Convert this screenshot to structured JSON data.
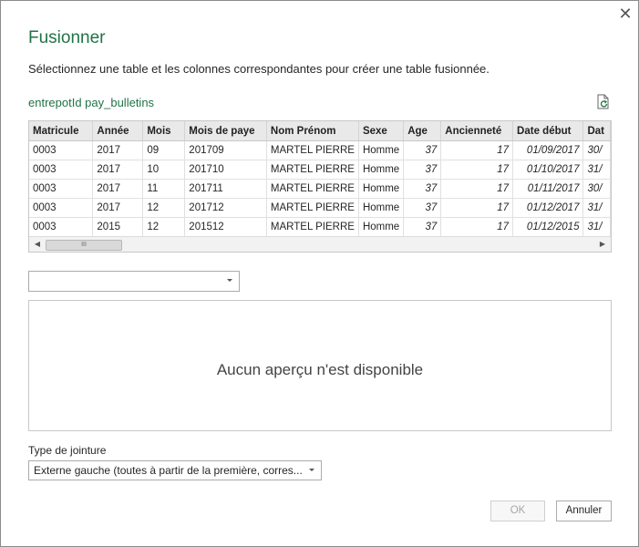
{
  "dialog": {
    "title": "Fusionner",
    "subtitle": "Sélectionnez une table et les colonnes correspondantes pour créer une table fusionnée.",
    "table_name": "entrepotId pay_bulletins",
    "close_glyph": "✕"
  },
  "grid": {
    "columns": [
      "Matricule",
      "Année",
      "Mois",
      "Mois de paye",
      "Nom Prénom",
      "Sexe",
      "Age",
      "Ancienneté",
      "Date début",
      "Dat"
    ],
    "rows": [
      [
        "0003",
        "2017",
        "09",
        "201709",
        "MARTEL PIERRE",
        "Homme",
        "37",
        "17",
        "01/09/2017",
        "30/"
      ],
      [
        "0003",
        "2017",
        "10",
        "201710",
        "MARTEL PIERRE",
        "Homme",
        "37",
        "17",
        "01/10/2017",
        "31/"
      ],
      [
        "0003",
        "2017",
        "11",
        "201711",
        "MARTEL PIERRE",
        "Homme",
        "37",
        "17",
        "01/11/2017",
        "30/"
      ],
      [
        "0003",
        "2017",
        "12",
        "201712",
        "MARTEL PIERRE",
        "Homme",
        "37",
        "17",
        "01/12/2017",
        "31/"
      ],
      [
        "0003",
        "2015",
        "12",
        "201512",
        "MARTEL PIERRE",
        "Homme",
        "37",
        "17",
        "01/12/2015",
        "31/"
      ]
    ],
    "scroll_left": "◀",
    "scroll_right": "▶",
    "scroll_grip": "III"
  },
  "second_table": {
    "selected": ""
  },
  "preview": {
    "empty_text": "Aucun aperçu n'est disponible"
  },
  "join": {
    "label": "Type de jointure",
    "selected": "Externe gauche (toutes à partir de la première, corres..."
  },
  "buttons": {
    "ok": "OK",
    "cancel": "Annuler"
  },
  "colors": {
    "accent": "#217346"
  }
}
